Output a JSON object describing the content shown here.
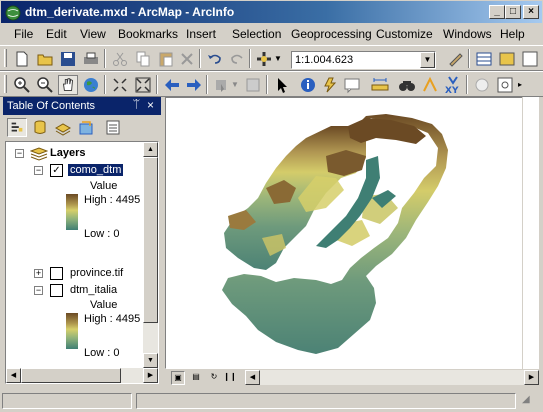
{
  "window": {
    "title": "dtm_derivate.mxd - ArcMap - ArcInfo",
    "minimize": "_",
    "maximize": "□",
    "close": "×"
  },
  "menu": [
    "File",
    "Edit",
    "View",
    "Bookmarks",
    "Insert",
    "Selection",
    "Geoprocessing",
    "Customize",
    "Windows",
    "Help"
  ],
  "toolbar": {
    "scale_value": "1:1.004.623"
  },
  "toc": {
    "title": "Table Of Contents",
    "pin": "ᛠ",
    "close": "×",
    "root": "Layers",
    "layers": [
      {
        "name": "como_dtm",
        "checked": true,
        "expanded": true,
        "legend_title": "Value",
        "high": "High : 4495",
        "low": "Low : 0"
      },
      {
        "name": "province.tif",
        "checked": false,
        "expanded": false
      },
      {
        "name": "dtm_italia",
        "checked": false,
        "expanded": true,
        "legend_title": "Value",
        "high": "High : 4495",
        "low": "Low : 0"
      }
    ]
  },
  "icons": {
    "app": "globe-icon",
    "new": "new-document-icon",
    "open": "open-folder-icon",
    "save": "save-icon",
    "print": "print-icon",
    "cut": "cut-icon",
    "copy": "copy-icon",
    "paste": "paste-icon",
    "delete": "delete-icon",
    "undo": "undo-icon",
    "redo": "redo-icon",
    "add_data": "add-data-icon",
    "zoom_in": "zoom-in-icon",
    "zoom_out": "zoom-out-icon",
    "pan": "pan-hand-icon",
    "full_extent": "globe-icon",
    "identify": "identify-icon"
  },
  "colors": {
    "title_gradient_start": "#0a246a",
    "title_gradient_end": "#a6caf0",
    "chrome": "#d4d0c8",
    "selection": "#0a246a",
    "dem_high": "#6b4a24",
    "dem_mid": "#d6cf6a",
    "dem_low": "#3f7f74"
  }
}
